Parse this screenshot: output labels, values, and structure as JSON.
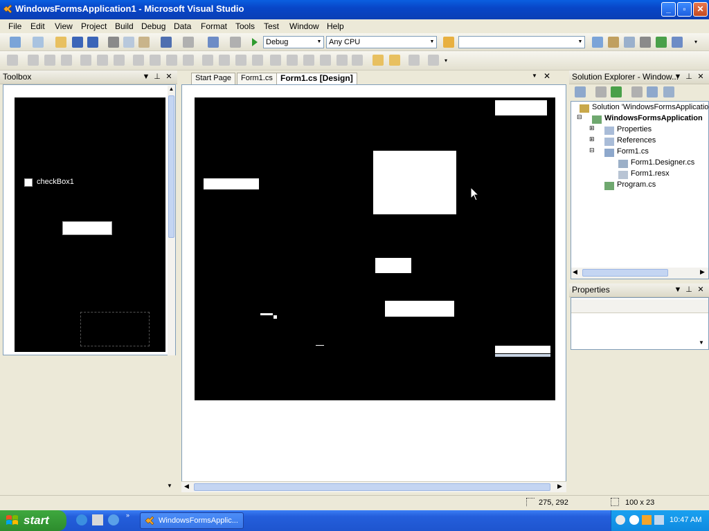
{
  "window": {
    "title": "WindowsFormsApplication1 - Microsoft Visual Studio",
    "minimize": "_",
    "maximize": "▫",
    "close": "✕"
  },
  "menu": [
    "File",
    "Edit",
    "View",
    "Project",
    "Build",
    "Debug",
    "Data",
    "Format",
    "Tools",
    "Test",
    "Window",
    "Help"
  ],
  "toolbar": {
    "config": "Debug",
    "platform": "Any CPU",
    "find": ""
  },
  "toolbox": {
    "title": "Toolbox",
    "checkbox_label": "checkBox1"
  },
  "designer": {
    "tabs": [
      "Start Page",
      "Form1.cs",
      "Form1.cs [Design]"
    ],
    "active_tab_index": 2
  },
  "solution_explorer": {
    "title": "Solution Explorer - Window...",
    "items": [
      {
        "label": "Solution 'WindowsFormsApplication",
        "bold": false
      },
      {
        "label": "WindowsFormsApplication",
        "bold": true
      },
      {
        "label": "Properties",
        "bold": false
      },
      {
        "label": "References",
        "bold": false
      },
      {
        "label": "Form1.cs",
        "bold": false
      },
      {
        "label": "Form1.Designer.cs",
        "bold": false
      },
      {
        "label": "Form1.resx",
        "bold": false
      },
      {
        "label": "Program.cs",
        "bold": false
      }
    ]
  },
  "properties": {
    "title": "Properties"
  },
  "statusbar": {
    "position": "275, 292",
    "size": "100 x 23"
  },
  "taskbar": {
    "start": "start",
    "task": "WindowsFormsApplic...",
    "clock": "10:47 AM"
  },
  "colors": {
    "titlebar": "#0a5fe0",
    "taskbar": "#245edb",
    "start": "#3fa83f",
    "chrome": "#ece9d8"
  }
}
